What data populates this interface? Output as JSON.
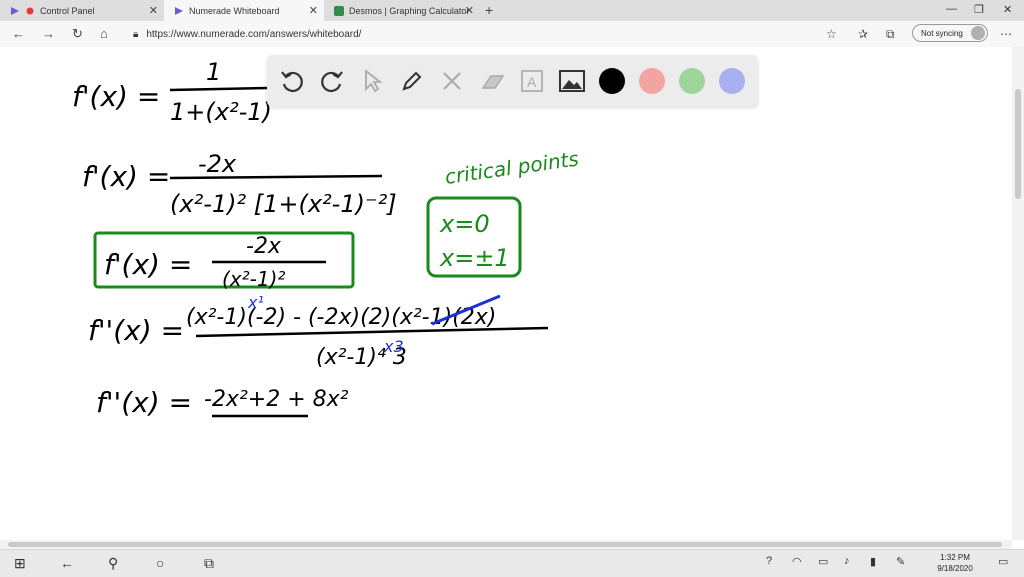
{
  "browser": {
    "tabs": [
      {
        "title": "Control Panel",
        "active": false
      },
      {
        "title": "Numerade Whiteboard",
        "active": true
      },
      {
        "title": "Desmos | Graphing Calculator",
        "active": false
      }
    ],
    "url": "https://www.numerade.com/answers/whiteboard/",
    "sync_label": "Not syncing"
  },
  "toolbar": {
    "tools": [
      "undo-icon",
      "redo-icon",
      "select-icon",
      "pen-icon",
      "tools-icon",
      "eraser-icon",
      "text-icon",
      "image-icon"
    ],
    "colors": [
      "#000000",
      "#f4a3a3",
      "#9ed49a",
      "#a9b0f0"
    ]
  },
  "whiteboard": {
    "equations": [
      {
        "lhs": "f'(x) =",
        "numerator": "1",
        "denominator": "1+(x²-1)"
      },
      {
        "lhs": "f'(x) =",
        "numerator": "-2x",
        "denominator": "(x²-1)² [1+(x²-1)⁻²]"
      },
      {
        "lhs": "f'(x) =",
        "numerator": "-2x",
        "denominator": "(x²-1)²",
        "boxed": true
      },
      {
        "lhs": "f''(x) =",
        "numerator": "(x²-1)(-2) - (-2x)(2)(x²-1)(2x)",
        "denominator": "(x²-1)⁴ 3"
      },
      {
        "lhs": "f''(x) =",
        "numerator": "-2x²+2 + 8x²",
        "denominator": ""
      }
    ],
    "annotation_title": "critical points",
    "annotation_items": [
      "x=0",
      "x=±1"
    ],
    "ink_colors": {
      "black": "#000000",
      "green": "#1a8a1a",
      "blue": "#1f2fd6"
    }
  },
  "taskbar": {
    "time": "1:32 PM",
    "date": "9/18/2020"
  }
}
